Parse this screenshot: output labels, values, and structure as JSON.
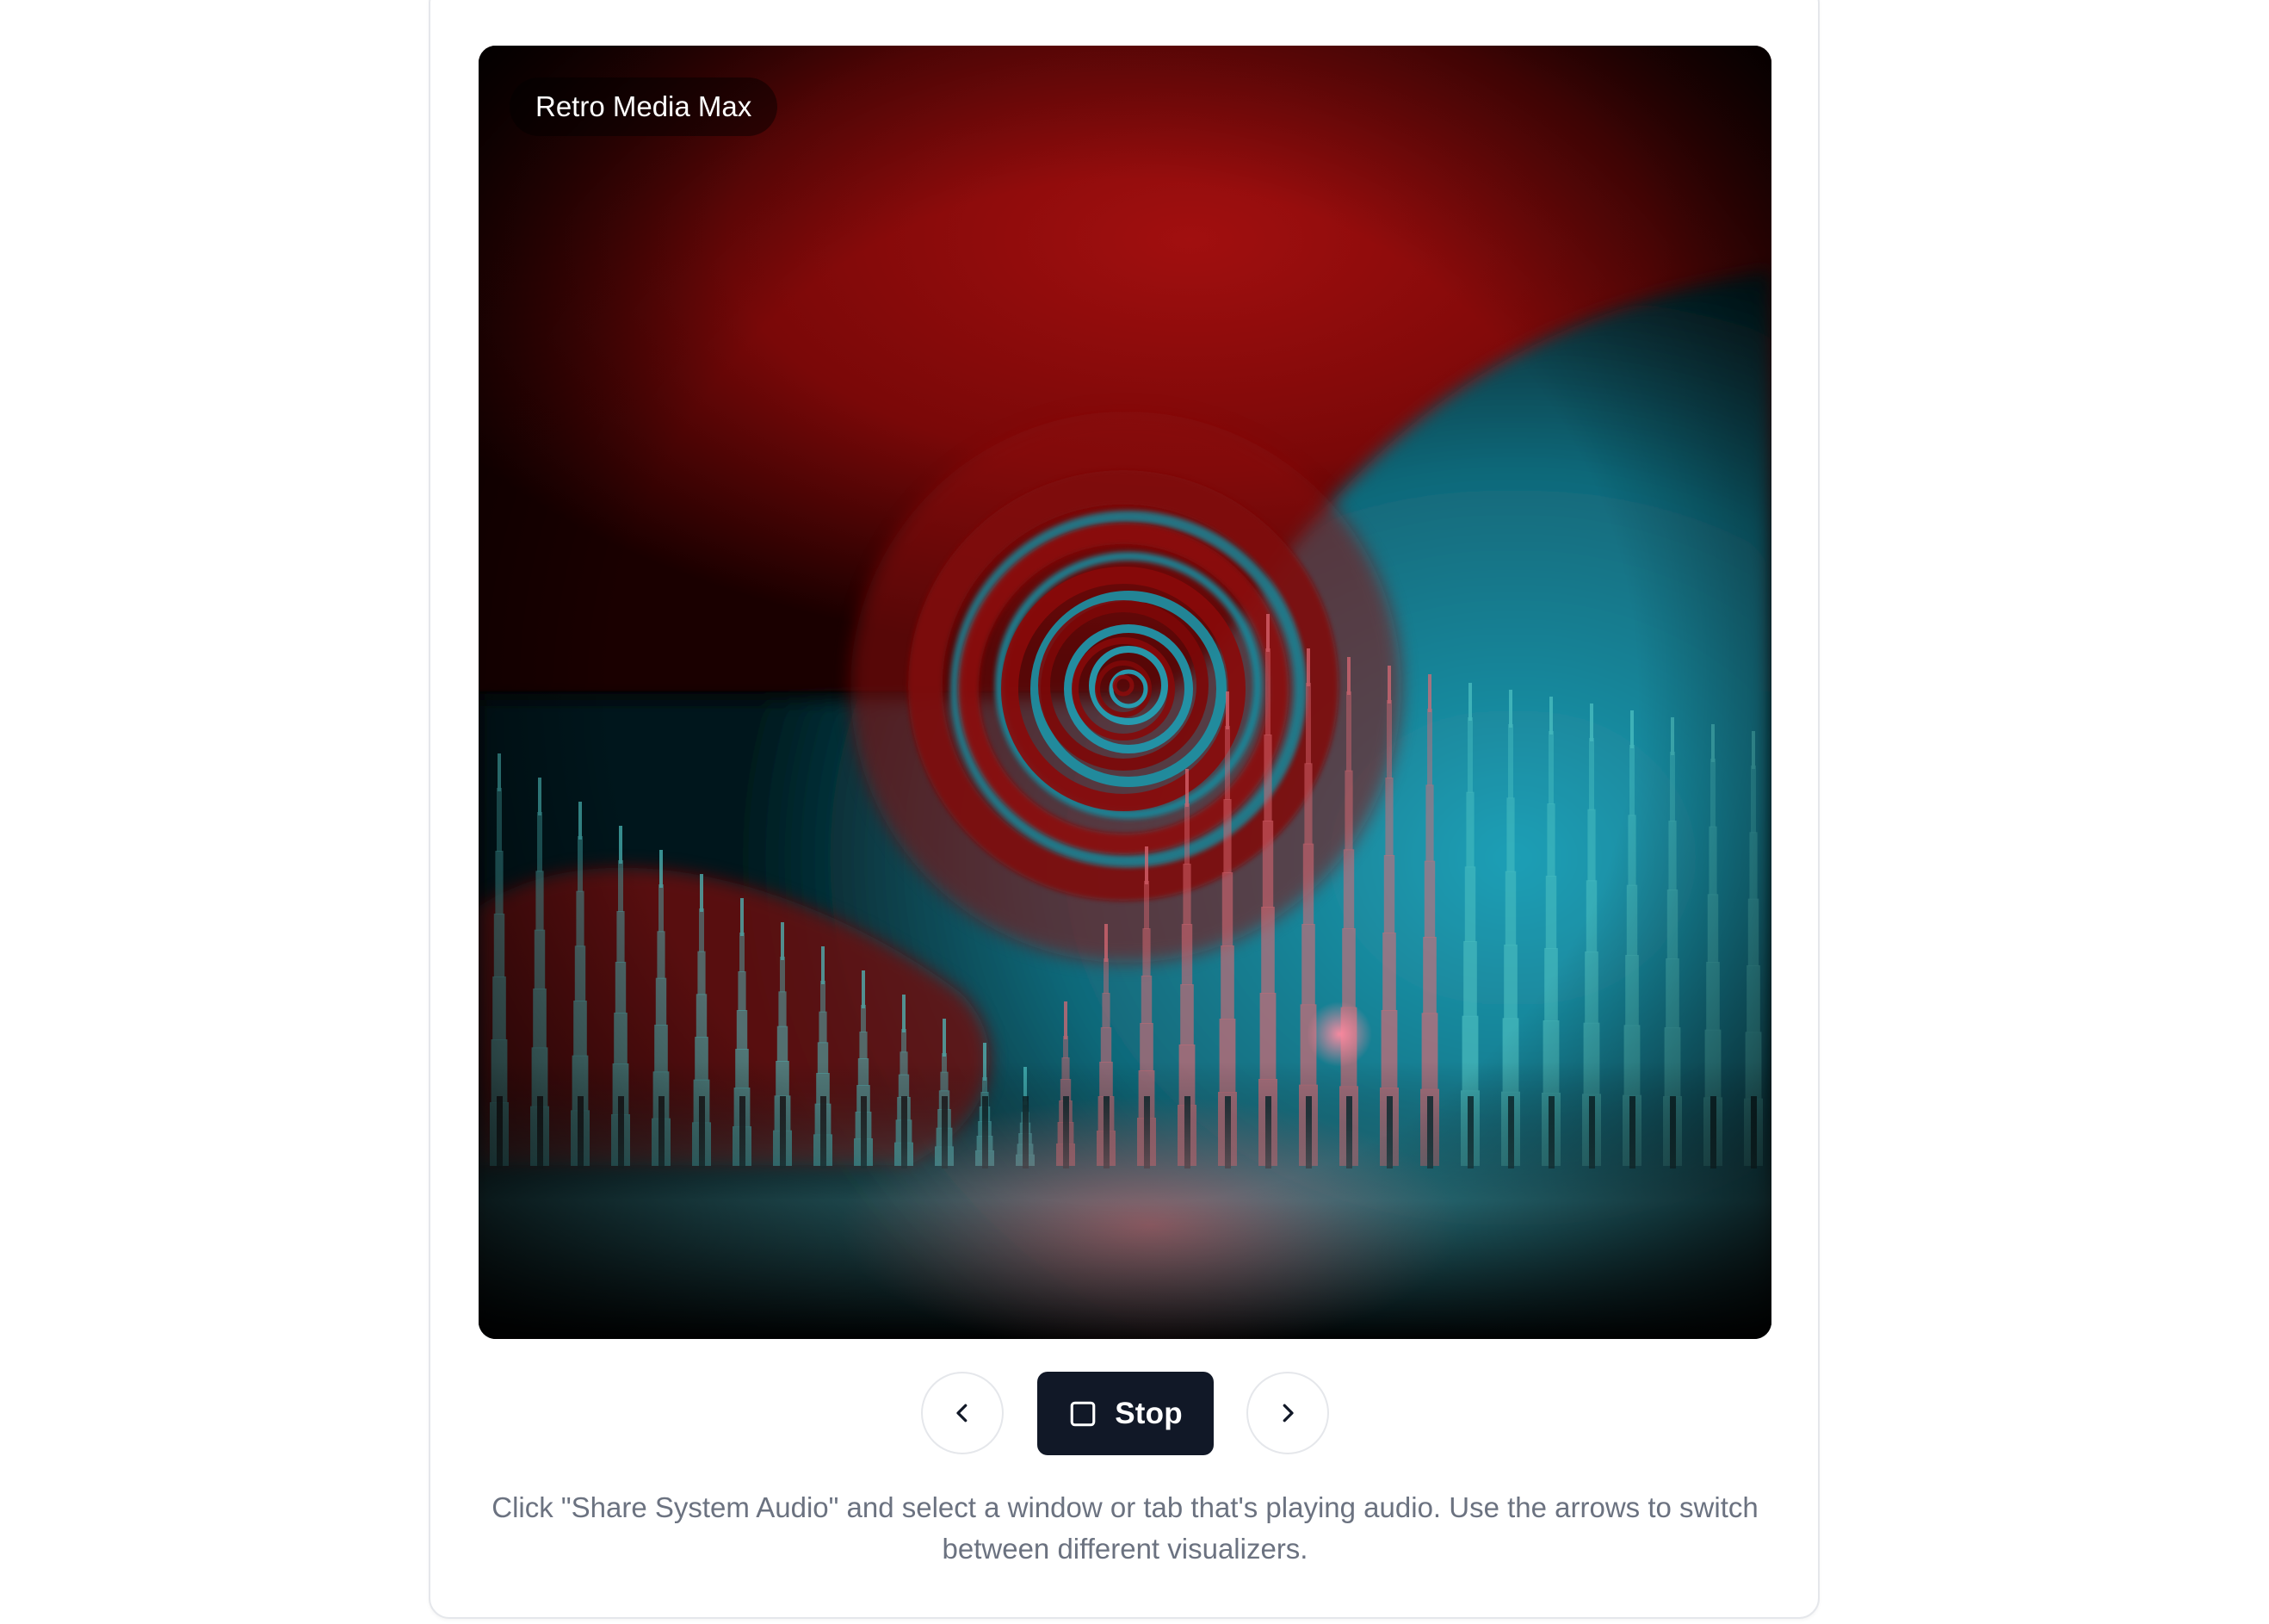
{
  "visualizer": {
    "title": "Retro Media Max",
    "colors": {
      "red": "#8a0b0b",
      "cyan": "#1a8fa5",
      "teal_bar": "#4fc3c3",
      "pink_bar": "#e06a75"
    }
  },
  "controls": {
    "prev_icon": "chevron-left-icon",
    "stop_label": "Stop",
    "stop_icon": "square-icon",
    "next_icon": "chevron-right-icon"
  },
  "hint": {
    "text": "Click \"Share System Audio\" and select a window or tab that's playing audio. Use the arrows to switch between different visualizers."
  }
}
